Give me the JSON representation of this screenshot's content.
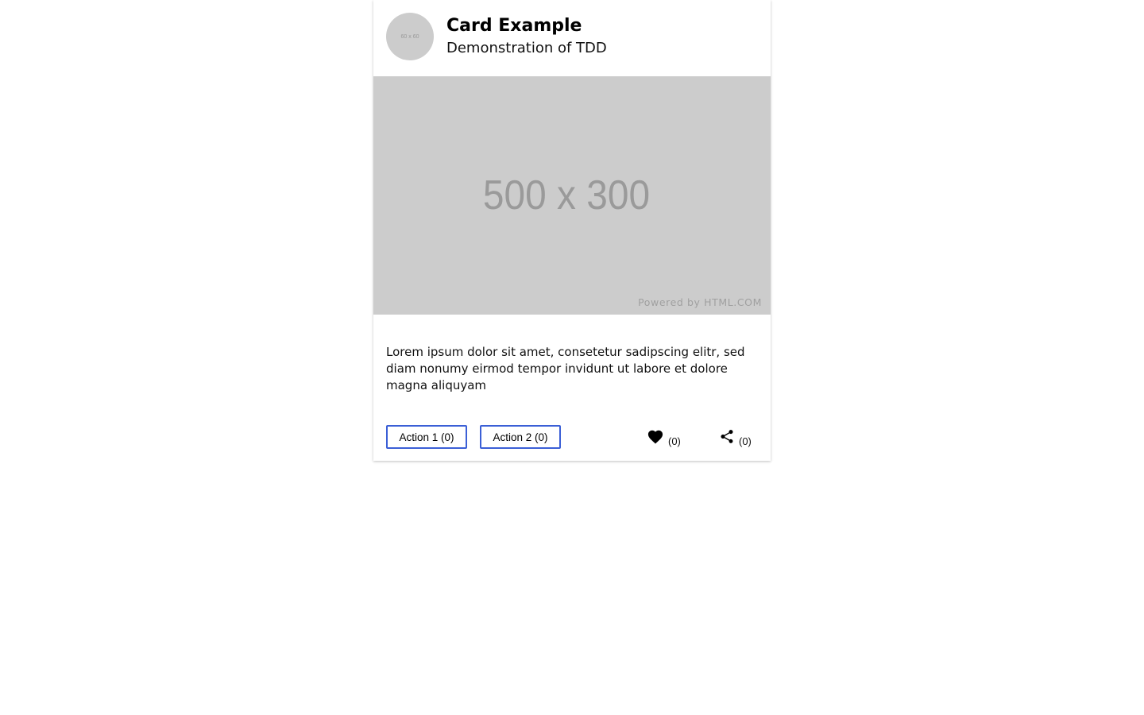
{
  "card": {
    "avatar_label": "60 x 60",
    "title": "Card Example",
    "subtitle": "Demonstration of TDD",
    "media": {
      "label": "500 x 300",
      "powered_by": "Powered by HTML.COM"
    },
    "content_text": "Lorem ipsum dolor sit amet, consetetur sadipscing elitr, sed diam nonumy eirmod tempor invidunt ut labore et dolore magna aliquyam",
    "actions": {
      "action1_label": "Action 1 (0)",
      "action2_label": "Action 2 (0)",
      "like_count": "(0)",
      "share_count": "(0)"
    }
  },
  "colors": {
    "button_border": "#3b5fd6",
    "placeholder_bg": "#cccccc",
    "placeholder_text": "#9a9a9a"
  },
  "icons": {
    "like": "heart-icon",
    "share": "share-icon"
  }
}
